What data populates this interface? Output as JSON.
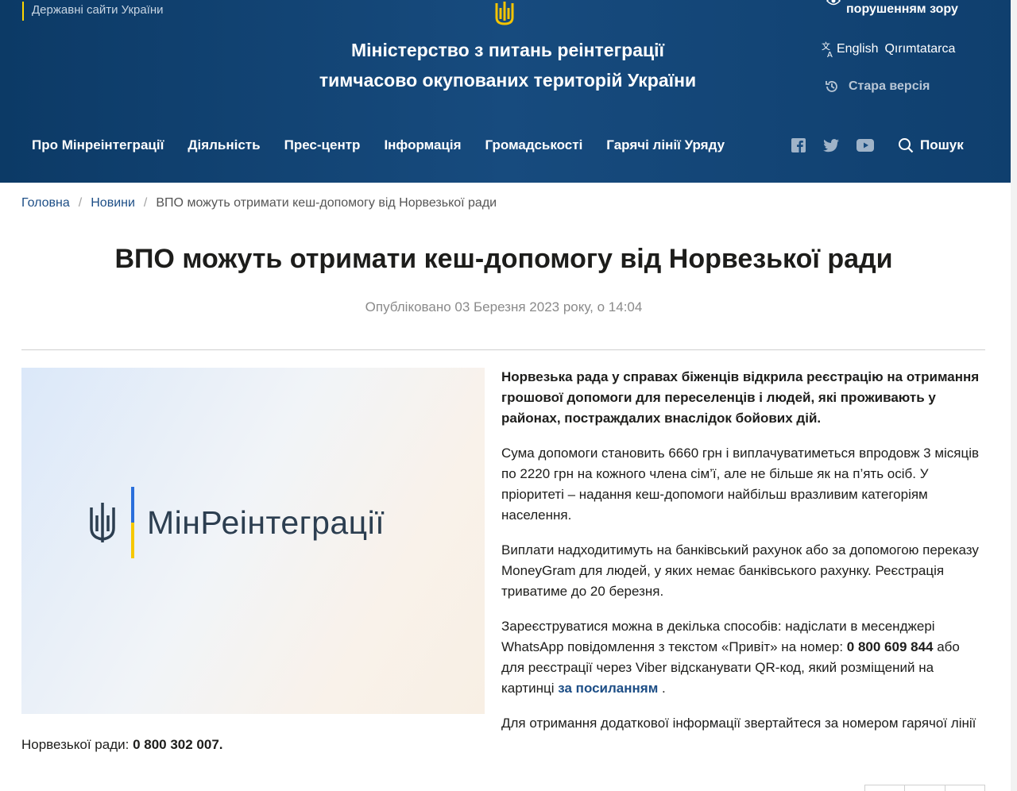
{
  "header": {
    "gov_sites_label": "Державні сайти України",
    "ministry_title_line1": "Міністерство з питань реінтеграції",
    "ministry_title_line2": "тимчасово окупованих територій України",
    "vision_label": "порушенням зору",
    "languages": [
      "English",
      "Qırımtatarca"
    ],
    "old_version_label": "Стара версія",
    "nav": [
      "Про Мінреінтеграції",
      "Діяльність",
      "Прес-центр",
      "Інформація",
      "Громадськості",
      "Гарячі лінії Уряду"
    ],
    "socials": [
      "facebook-icon",
      "twitter-icon",
      "youtube-icon"
    ],
    "search_label": "Пошук"
  },
  "breadcrumb": {
    "home": "Головна",
    "news": "Новини",
    "current": "ВПО можуть отримати кеш-допомогу від Норвезької ради"
  },
  "article": {
    "title": "ВПО можуть отримати кеш-допомогу від Норвезької ради",
    "published": "Опубліковано 03 Березня 2023 року, о 14:04",
    "image_logo_text": "МінРеінтеграції",
    "lead": "Норвезька рада у справах біженців відкрила реєстрацію на отримання грошової допомоги для переселенців і людей, які проживають у районах, постраждалих внаслідок бойових дій.",
    "p2": "Сума допомоги становить 6660 грн і виплачуватиметься впродовж 3 місяців по 2220 грн на кожного члена сім’ї, але не більше як на п’ять осіб. У пріоритеті – надання кеш-допомоги найбільш вразливим категоріям населення.",
    "p3": "Виплати надходитимуть на банківський рахунок або за допомогою переказу MoneyGram для людей, у яких немає банківського рахунку. Реєстрація триватиме до 20 березня.",
    "p4_part1": "Зареєструватися можна в декілька способів: надіслати в месенджері WhatsApp повідомлення з текстом «Привіт» на номер: ",
    "p4_phone": "0 800 609 844",
    "p4_part2": " або для реєстрації через Viber відсканувати QR-код, який розміщений на картинці ",
    "p4_link": "за посиланням",
    "p4_part3": " .",
    "p5_part1": "Для отримання додаткової інформації звертайтеся за номером гарячої лінії",
    "p5_part2": "Норвезької ради: ",
    "p5_phone": "0 800 302 007."
  },
  "colors": {
    "header_bg": "#174b7e",
    "accent_yellow": "#ffd500",
    "link": "#1d4e86"
  }
}
